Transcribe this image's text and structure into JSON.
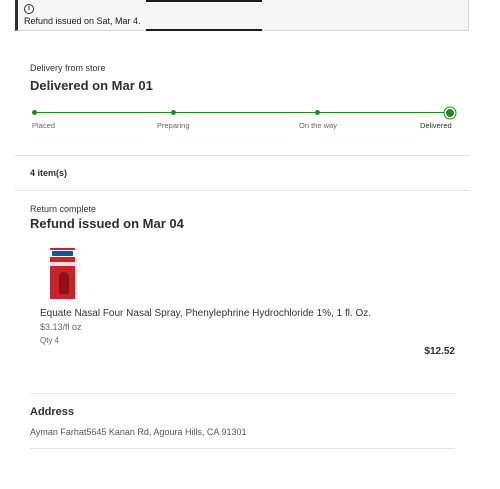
{
  "notice": {
    "icon": "info-icon",
    "text": "Refund issued on Sat, Mar 4."
  },
  "delivery": {
    "label": "Delivery from store",
    "title": "Delivered on Mar 01",
    "steps": [
      {
        "label": "Placed",
        "done": true
      },
      {
        "label": "Preparing",
        "done": true
      },
      {
        "label": "On the way",
        "done": true
      },
      {
        "label": "Delivered",
        "done": true,
        "current": true
      }
    ],
    "accent_color": "#208a20"
  },
  "items": {
    "count_label": "4 item(s)"
  },
  "return": {
    "label": "Return complete",
    "title": "Refund issued on Mar 04",
    "product": {
      "name": "Equate Nasal Four Nasal Spray, Phenylephrine Hydrochloride 1%, 1 fl. Oz.",
      "unit_price": "$3.13/fl oz",
      "qty": "Qty 4",
      "total": "$12.52"
    }
  },
  "address": {
    "title": "Address",
    "text": "Ayman Farhat5645 Kanan Rd, Agoura Hills, CA 91301"
  }
}
